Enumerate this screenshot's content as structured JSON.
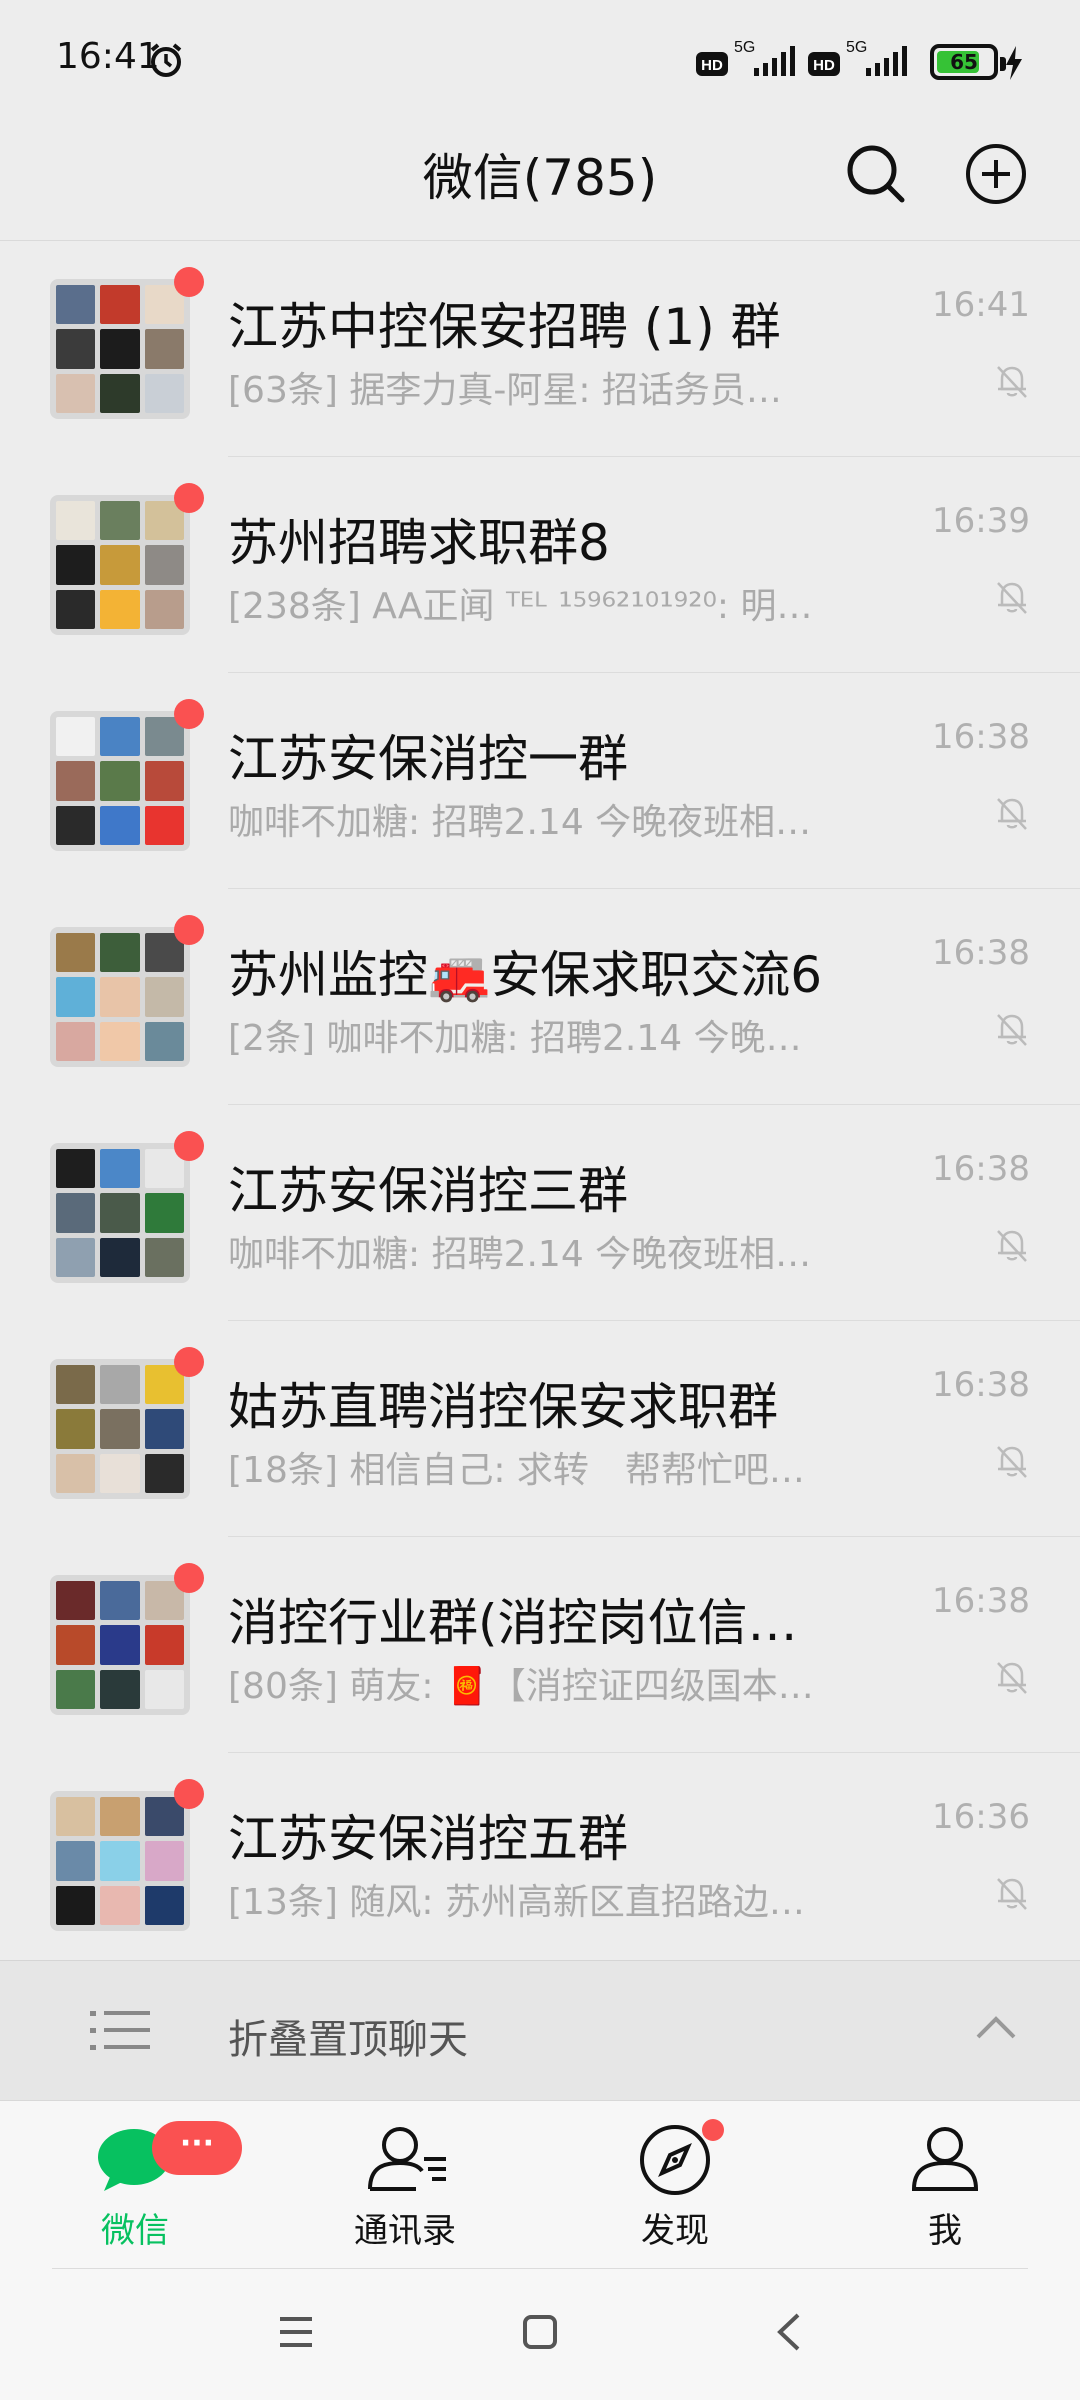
{
  "status_bar": {
    "time": "16:41",
    "battery": "65",
    "network_labels": [
      "HD",
      "5G",
      "HD",
      "5G"
    ]
  },
  "header": {
    "title": "微信(785)"
  },
  "chats": [
    {
      "name": "江苏中控保安招聘 (1) 群",
      "preview": "[63条] 据李力真-阿星: 招话务员…",
      "time": "16:41",
      "muted": true,
      "unread_dot": true
    },
    {
      "name": "苏州招聘求职群8",
      "preview": "[238条] AA正闻 ᵀᴱᴸ ¹⁵⁹⁶²¹⁰¹⁹²⁰: 明…",
      "time": "16:39",
      "muted": true,
      "unread_dot": true
    },
    {
      "name": "江苏安保消控一群",
      "preview": "咖啡不加糖: 招聘2.14 今晚夜班相…",
      "time": "16:38",
      "muted": true,
      "unread_dot": true
    },
    {
      "name": "苏州监控🚒安保求职交流6",
      "preview": "[2条] 咖啡不加糖: 招聘2.14 今晚…",
      "time": "16:38",
      "muted": true,
      "unread_dot": true
    },
    {
      "name": "江苏安保消控三群",
      "preview": "咖啡不加糖: 招聘2.14 今晚夜班相…",
      "time": "16:38",
      "muted": true,
      "unread_dot": true
    },
    {
      "name": "姑苏直聘消控保安求职群",
      "preview": "[18条] 相信自己: 求转　帮帮忙吧…",
      "time": "16:38",
      "muted": true,
      "unread_dot": true
    },
    {
      "name": "消控行业群(消控岗位信…",
      "preview": "[80条] 萌友: 🧧【消控证四级国本…",
      "time": "16:38",
      "muted": true,
      "unread_dot": true
    },
    {
      "name": "江苏安保消控五群",
      "preview": "[13条] 随风: 苏州高新区直招路边…",
      "time": "16:36",
      "muted": true,
      "unread_dot": true
    }
  ],
  "fold": {
    "label": "折叠置顶聊天"
  },
  "tabs": [
    {
      "label": "微信",
      "icon": "chat-bubble-icon",
      "active": true,
      "badge": "···"
    },
    {
      "label": "通讯录",
      "icon": "contacts-icon",
      "active": false
    },
    {
      "label": "发现",
      "icon": "compass-icon",
      "active": false,
      "dot": true
    },
    {
      "label": "我",
      "icon": "person-icon",
      "active": false
    }
  ],
  "colors": {
    "accent": "#07c160",
    "badge": "#fa5151",
    "background": "#ededed"
  }
}
